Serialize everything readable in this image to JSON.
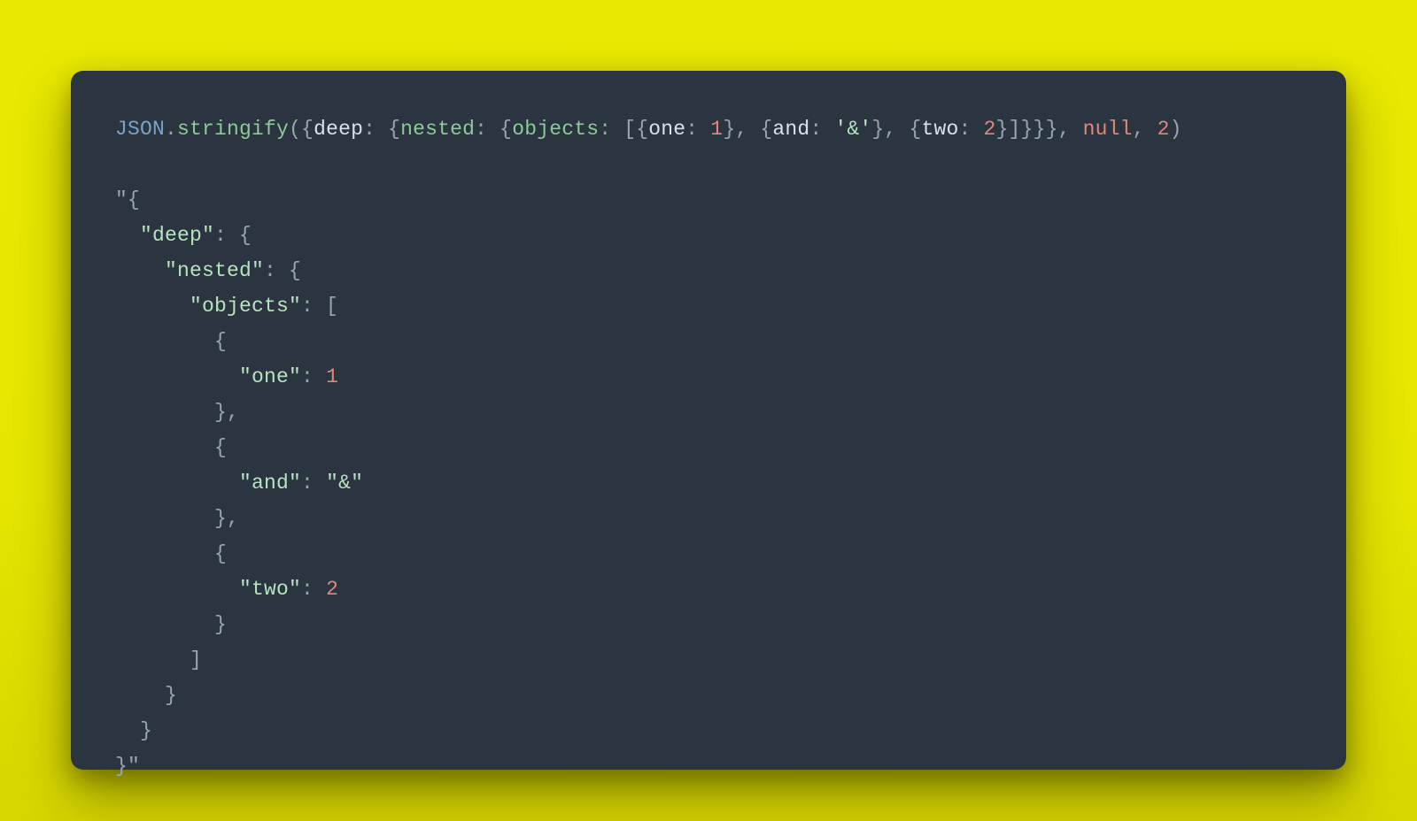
{
  "call": {
    "className": "JSON",
    "dot": ".",
    "method": "stringify",
    "open": "(",
    "arg": {
      "open": "{",
      "deepKey": "deep",
      "colon": ": ",
      "open2": "{",
      "nestedKey": "nested",
      "open3": "{",
      "objectsKey": "objects",
      "arrOpen": "[",
      "item1Open": "{",
      "item1Key": "one",
      "item1Val": "1",
      "item1Close": "}",
      "comma": ", ",
      "item2Open": "{",
      "item2Key": "and",
      "item2Val": "'&'",
      "item2Close": "}",
      "item3Open": "{",
      "item3Key": "two",
      "item3Val": "2",
      "item3Close": "}",
      "arrClose": "]",
      "close3": "}",
      "close2": "}",
      "close": "}"
    },
    "sep1": ", ",
    "arg2": "null",
    "sep2": ", ",
    "arg3": "2",
    "closeParen": ")"
  },
  "output": {
    "l01": "\"{",
    "l02_indent": "  ",
    "l02_key": "\"deep\"",
    "l02_rest": ": {",
    "l03_indent": "    ",
    "l03_key": "\"nested\"",
    "l03_rest": ": {",
    "l04_indent": "      ",
    "l04_key": "\"objects\"",
    "l04_rest": ": [",
    "l05": "        {",
    "l06_indent": "          ",
    "l06_key": "\"one\"",
    "l06_colon": ": ",
    "l06_val": "1",
    "l07": "        },",
    "l08": "        {",
    "l09_indent": "          ",
    "l09_key": "\"and\"",
    "l09_colon": ": ",
    "l09_val": "\"&\"",
    "l10": "        },",
    "l11": "        {",
    "l12_indent": "          ",
    "l12_key": "\"two\"",
    "l12_colon": ": ",
    "l12_val": "2",
    "l13": "        }",
    "l14": "      ]",
    "l15": "    }",
    "l16": "  }",
    "l17": "}\""
  }
}
